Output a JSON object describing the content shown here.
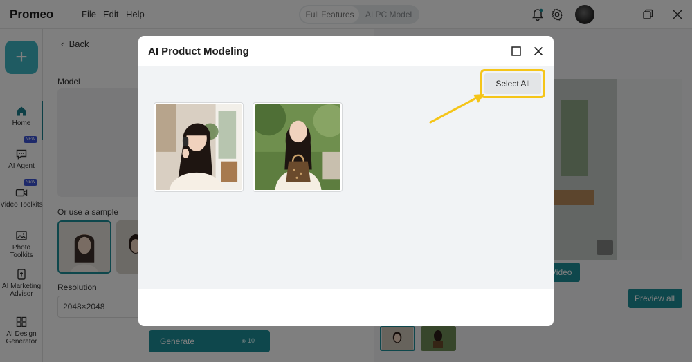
{
  "app": {
    "name": "Promeo"
  },
  "menu": [
    "File",
    "Edit",
    "Help"
  ],
  "mode_toggle": {
    "options": [
      "Full Features",
      "AI PC Model"
    ],
    "active": 0
  },
  "sidebar": {
    "new_label": "+",
    "items": [
      {
        "label": "Home",
        "icon": "home-icon",
        "active": true
      },
      {
        "label": "AI Agent",
        "icon": "ai-agent-icon",
        "badge": "NEW"
      },
      {
        "label": "Video Toolkits",
        "icon": "video-icon",
        "badge": "NEW"
      },
      {
        "label": "Photo Toolkits",
        "icon": "photo-icon"
      },
      {
        "label": "AI Marketing Advisor",
        "icon": "marketing-icon"
      },
      {
        "label": "AI Design Generator",
        "icon": "design-icon"
      }
    ]
  },
  "panel": {
    "back_label": "Back",
    "model_label": "Model",
    "sample_label": "Or use a sample",
    "resolution_label": "Resolution",
    "resolution_value": "2048×2048",
    "generate_label": "Generate",
    "generate_cost": "10"
  },
  "right": {
    "video_label": "Video",
    "preview_all_label": "Preview all"
  },
  "modal": {
    "title": "AI Product Modeling",
    "select_all_label": "Select All",
    "images": [
      {
        "description": "woman-with-headphones"
      },
      {
        "description": "woman-with-handbag"
      }
    ]
  },
  "colors": {
    "accent": "#1c8e99",
    "highlight": "#f5c518",
    "badge": "#3b52d4"
  }
}
